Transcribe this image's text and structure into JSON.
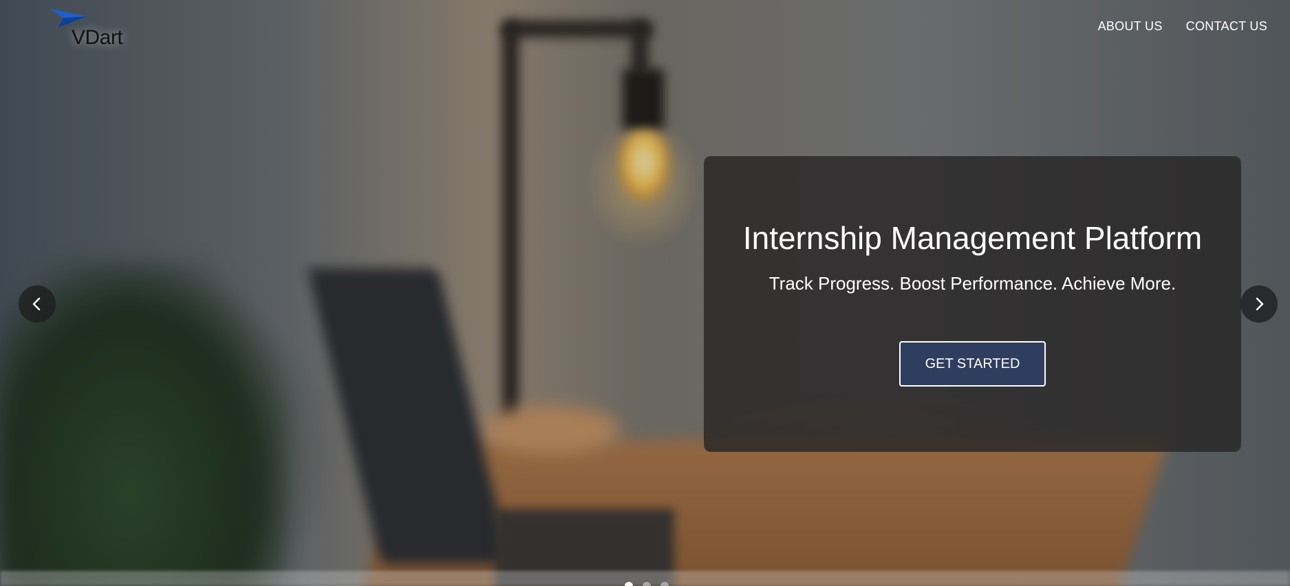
{
  "brand": {
    "name": "VDart",
    "logo_icon": "paper-plane-icon",
    "logo_color": "#1f5fc9"
  },
  "nav": {
    "items": [
      {
        "label": "ABOUT US"
      },
      {
        "label": "CONTACT US"
      }
    ]
  },
  "hero": {
    "title": "Internship Management Platform",
    "subtitle": "Track Progress. Boost Performance. Achieve More.",
    "cta_label": "GET STARTED",
    "cta_color": "#2f3d5e"
  },
  "carousel": {
    "prev_icon": "chevron-left-icon",
    "next_icon": "chevron-right-icon",
    "slide_count": 3,
    "active_index": 0
  }
}
